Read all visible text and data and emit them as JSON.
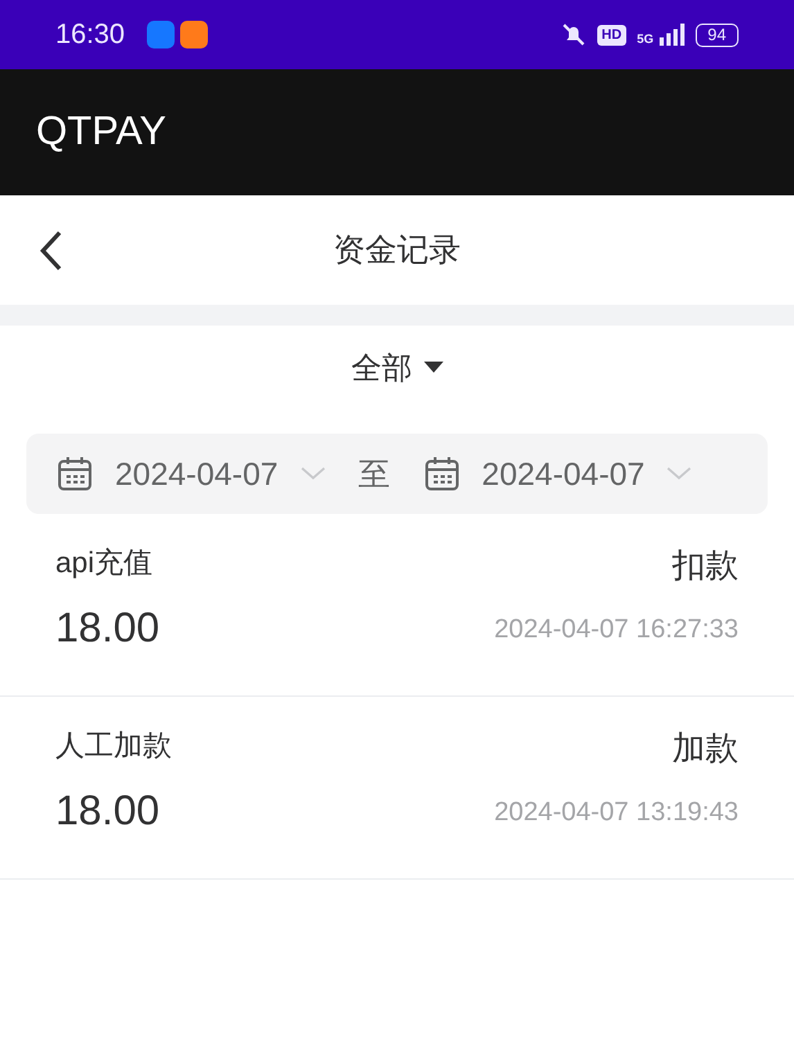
{
  "status_bar": {
    "time": "16:30",
    "hd_label": "HD",
    "network_label": "5G",
    "battery": "94"
  },
  "app_bar": {
    "title": "QTPAY"
  },
  "header": {
    "title": "资金记录"
  },
  "filter": {
    "label": "全部"
  },
  "date_range": {
    "start": "2024-04-07",
    "separator": "至",
    "end": "2024-04-07"
  },
  "records": [
    {
      "name": "api充值",
      "amount": "18.00",
      "type": "扣款",
      "time": "2024-04-07 16:27:33"
    },
    {
      "name": "人工加款",
      "amount": "18.00",
      "type": "加款",
      "time": "2024-04-07 13:19:43"
    }
  ]
}
